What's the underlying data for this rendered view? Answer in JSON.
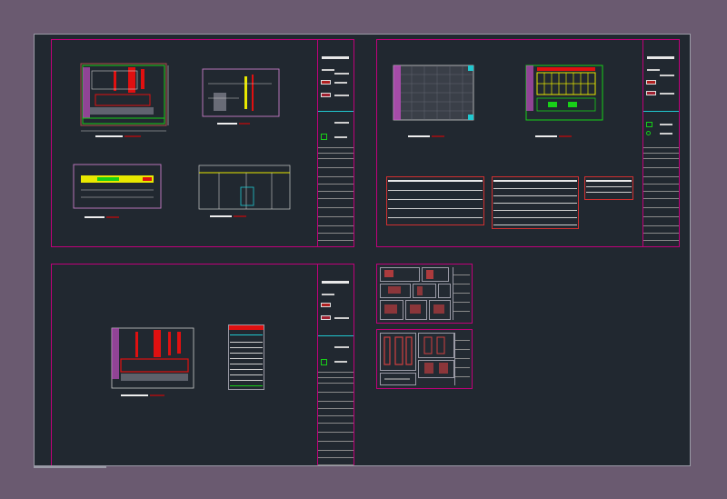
{
  "app": {
    "window_title": "",
    "background": "#6a5a70",
    "canvas_bg": "#212830"
  },
  "colors": {
    "sheet_border": "#c0007a",
    "wall_red": "#e01010",
    "hatch_green": "#18d018",
    "fill_yellow": "#e8e800",
    "highlight_magenta": "#c050c0",
    "cyan": "#20c8d0"
  },
  "sheets": [
    {
      "id": "sheet-1",
      "kind": "floor-plans-and-sections",
      "drawings": 4
    },
    {
      "id": "sheet-2",
      "kind": "ceiling-plans-and-schedules",
      "drawings": 2,
      "tables": 3
    },
    {
      "id": "sheet-3",
      "kind": "plan-with-legend",
      "drawings": 1
    }
  ],
  "detail_sheets": [
    {
      "id": "detail-a",
      "cells": 12
    },
    {
      "id": "detail-b",
      "cells": 8
    }
  ],
  "icons": [
    "title-block-logo-icon",
    "legend-swatch-icon"
  ]
}
